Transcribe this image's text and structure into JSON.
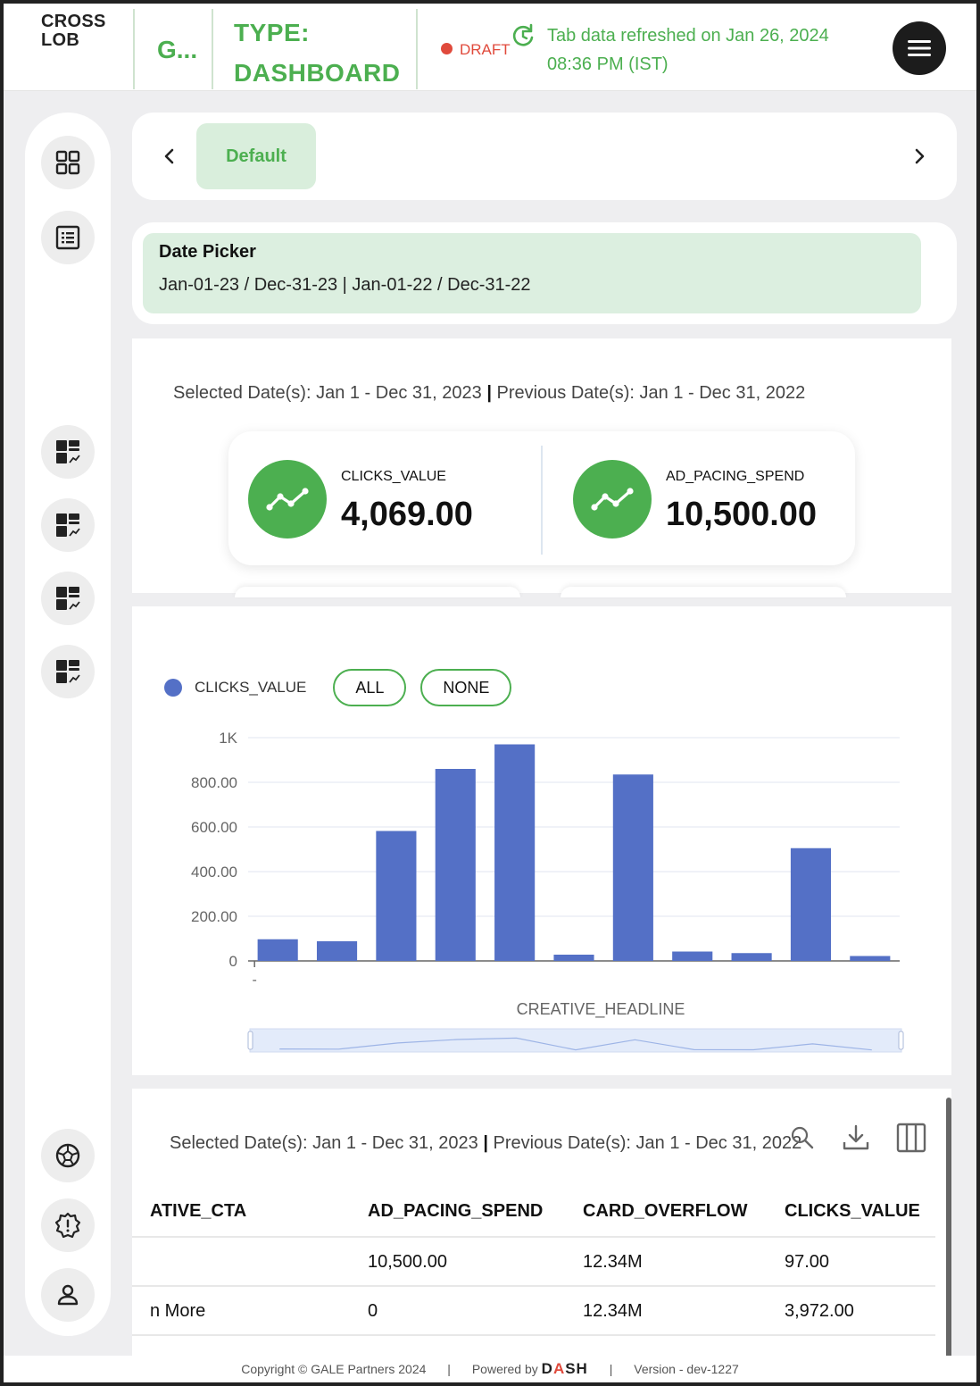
{
  "header": {
    "brand_line1": "CROSS",
    "brand_line2": "LOB",
    "abbr": "G...",
    "type_line1": "TYPE:",
    "type_line2": "DASHBOARD",
    "status": "DRAFT",
    "refresh_line1": "Tab data refreshed on Jan 26, 2024",
    "refresh_line2": "08:36 PM (IST)",
    "menu_icon": "hamburger-icon"
  },
  "tabs": {
    "items": [
      "Default"
    ],
    "prev_icon": "chevron-left-icon",
    "next_icon": "chevron-right-icon"
  },
  "date_picker": {
    "label": "Date Picker",
    "value": "Jan-01-23 / Dec-31-23 | Jan-01-22 / Dec-31-22"
  },
  "kpi_section": {
    "selected_prefix": "Selected Date(s): Jan 1 - Dec 31, 2023",
    "sep": "|",
    "previous": "Previous Date(s): Jan 1 - Dec 31, 2022",
    "kpis": [
      {
        "label": "CLICKS_VALUE",
        "value": "4,069.00",
        "icon": "trend-line-icon"
      },
      {
        "label": "AD_PACING_SPEND",
        "value": "10,500.00",
        "icon": "trend-line-icon"
      }
    ]
  },
  "chart_section": {
    "legend_label": "CLICKS_VALUE",
    "all_label": "ALL",
    "none_label": "NONE",
    "x_first_tick": "-",
    "colors": {
      "series": "#5470c6",
      "accent": "#4caf50"
    }
  },
  "chart_data": {
    "type": "bar",
    "categories": [
      "-",
      "",
      "",
      "",
      "",
      "",
      "",
      "",
      "",
      "",
      ""
    ],
    "series": [
      {
        "name": "CLICKS_VALUE",
        "values": [
          97,
          88,
          582,
          860,
          970,
          28,
          835,
          42,
          35,
          505,
          22
        ]
      }
    ],
    "xlabel": "CREATIVE_HEADLINE",
    "ylabel": "",
    "yticks": [
      "0",
      "200.00",
      "400.00",
      "600.00",
      "800.00",
      "1K"
    ],
    "ylim": [
      0,
      1000
    ],
    "grid": true,
    "legend": "top-left"
  },
  "table_section": {
    "selected_prefix": "Selected Date(s): Jan 1 - Dec 31, 2023",
    "sep": "|",
    "previous": "Previous Date(s): Jan 1 - Dec 31, 2022",
    "tools": [
      "search-icon",
      "download-icon",
      "columns-icon"
    ],
    "columns": [
      "ATIVE_CTA",
      "AD_PACING_SPEND",
      "CARD_OVERFLOW",
      "CLICKS_VALUE"
    ],
    "rows": [
      [
        "",
        "10,500.00",
        "12.34M",
        "97.00"
      ],
      [
        "n More",
        "0",
        "12.34M",
        "3,972.00"
      ]
    ]
  },
  "sidebar": {
    "items": [
      "dashboard-grid-icon",
      "list-icon",
      "widget-chart-icon",
      "widget-chart-icon",
      "widget-chart-icon",
      "widget-chart-icon",
      "soccer-ball-icon",
      "badge-alert-icon",
      "user-icon"
    ]
  },
  "footer": {
    "copyright": "Copyright © GALE Partners 2024",
    "powered_by": "Powered by",
    "dash_d": "D",
    "dash_a": "A",
    "dash_sh": "SH",
    "version": "Version - dev-1227"
  }
}
